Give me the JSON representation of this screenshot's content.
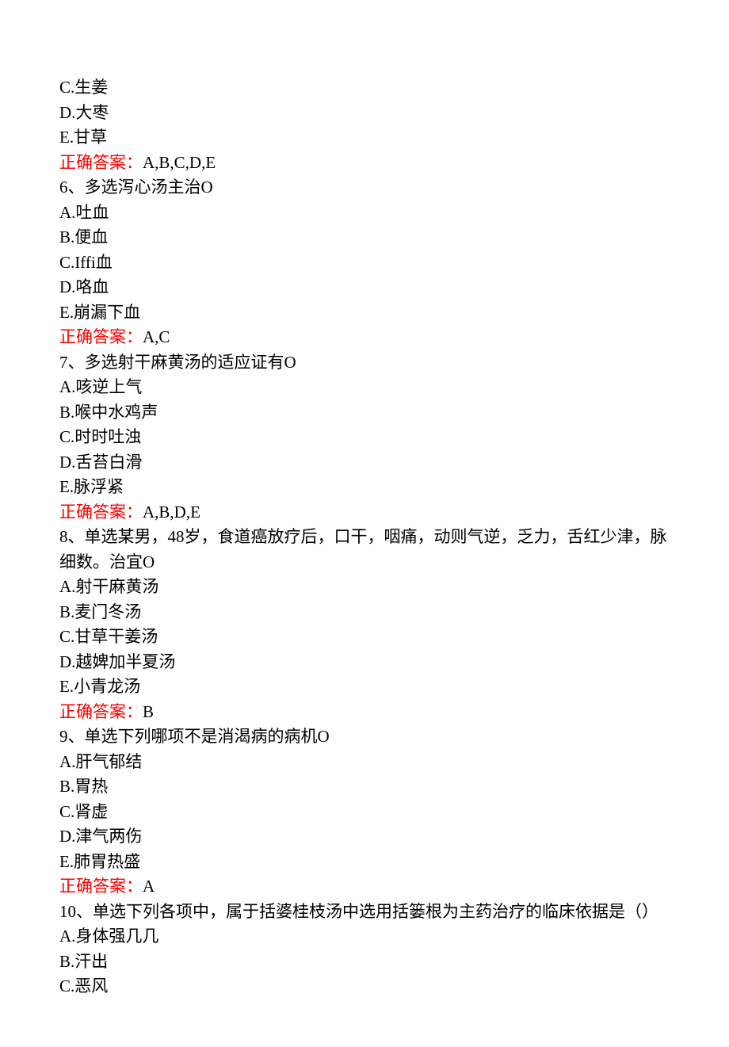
{
  "lines": [
    {
      "text": "C.生姜"
    },
    {
      "text": "D.大枣"
    },
    {
      "text": "E.甘草"
    },
    {
      "answer_label": "正确答案：",
      "answer_value": "A,B,C,D,E"
    },
    {
      "text": "6、多选泻心汤主治O"
    },
    {
      "text": "A.吐血"
    },
    {
      "text": "B.便血"
    },
    {
      "text": "C.Iffi血"
    },
    {
      "text": "D.咯血"
    },
    {
      "text": "E.崩漏下血"
    },
    {
      "answer_label": "正确答案：",
      "answer_value": "A,C"
    },
    {
      "text": "7、多选射干麻黄汤的适应证有O"
    },
    {
      "text": "A.咳逆上气"
    },
    {
      "text": "B.喉中水鸡声"
    },
    {
      "text": "C.时时吐浊"
    },
    {
      "text": "D.舌苔白滑"
    },
    {
      "text": "E.脉浮紧"
    },
    {
      "answer_label": "正确答案：",
      "answer_value": "A,B,D,E"
    },
    {
      "text": "8、单选某男，48岁，食道癌放疗后，口干，咽痛，动则气逆，乏力，舌红少津，脉细数。治宜O"
    },
    {
      "text": "A.射干麻黄汤"
    },
    {
      "text": "B.麦门冬汤"
    },
    {
      "text": "C.甘草干姜汤"
    },
    {
      "text": "D.越婢加半夏汤"
    },
    {
      "text": "E.小青龙汤"
    },
    {
      "answer_label": "正确答案：",
      "answer_value": "B"
    },
    {
      "text": "9、单选下列哪项不是消渴病的病机O"
    },
    {
      "text": "A.肝气郁结"
    },
    {
      "text": "B.胃热"
    },
    {
      "text": "C.肾虚"
    },
    {
      "text": "D.津气两伤"
    },
    {
      "text": "E.肺胃热盛"
    },
    {
      "answer_label": "正确答案：",
      "answer_value": "A"
    },
    {
      "text": "10、单选下列各项中，属于括婆桂枝汤中选用括篓根为主药治疗的临床依据是（）"
    },
    {
      "text": "A.身体强几几"
    },
    {
      "text": "B.汗出"
    },
    {
      "text": "C.恶风"
    }
  ]
}
